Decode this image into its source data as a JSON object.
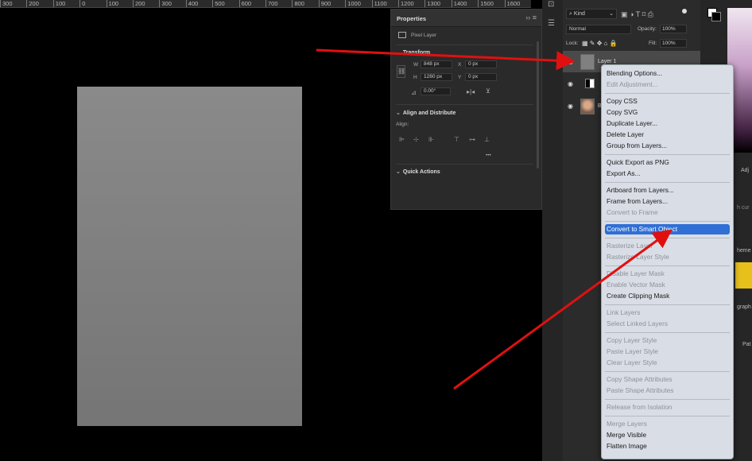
{
  "ruler": {
    "ticks": [
      "300",
      "200",
      "100",
      "0",
      "100",
      "200",
      "300",
      "400",
      "500",
      "600",
      "700",
      "800",
      "900",
      "1000",
      "1100",
      "1200",
      "1300",
      "1400",
      "1500",
      "1600"
    ]
  },
  "properties": {
    "title": "Properties",
    "layer_type": "Pixel Layer",
    "transform_title": "Transform",
    "w_label": "W",
    "w_value": "848 px",
    "x_label": "X",
    "x_value": "0 px",
    "h_label": "H",
    "h_value": "1280 px",
    "y_label": "Y",
    "y_value": "0 px",
    "angle_value": "0.00°",
    "align_title": "Align and Distribute",
    "align_label": "Align:",
    "more": "•••",
    "quick_actions_title": "Quick Actions"
  },
  "layers_panel": {
    "kind": "Kind",
    "blend_mode": "Normal",
    "opacity_label": "Opacity:",
    "opacity_value": "100%",
    "lock_label": "Lock:",
    "fill_label": "Fill:",
    "fill_value": "100%",
    "layers": [
      {
        "name": "Layer 1"
      },
      {
        "name": ""
      },
      {
        "name": "B"
      }
    ]
  },
  "right_panel": {
    "adj": "Adj",
    "cur": "h cur",
    "theme": "heme",
    "graph": "graph",
    "pat": "Pat"
  },
  "context_menu": {
    "items": [
      {
        "label": "Blending Options...",
        "disabled": false
      },
      {
        "label": "Edit Adjustment...",
        "disabled": true
      },
      {
        "sep": true
      },
      {
        "label": "Copy CSS",
        "disabled": false
      },
      {
        "label": "Copy SVG",
        "disabled": false
      },
      {
        "label": "Duplicate Layer...",
        "disabled": false
      },
      {
        "label": "Delete Layer",
        "disabled": false
      },
      {
        "label": "Group from Layers...",
        "disabled": false
      },
      {
        "sep": true
      },
      {
        "label": "Quick Export as PNG",
        "disabled": false
      },
      {
        "label": "Export As...",
        "disabled": false
      },
      {
        "sep": true
      },
      {
        "label": "Artboard from Layers...",
        "disabled": false
      },
      {
        "label": "Frame from Layers...",
        "disabled": false
      },
      {
        "label": "Convert to Frame",
        "disabled": true
      },
      {
        "sep": true
      },
      {
        "label": "Convert to Smart Object",
        "disabled": false,
        "highlighted": true
      },
      {
        "sep": true
      },
      {
        "label": "Rasterize Layer",
        "disabled": true
      },
      {
        "label": "Rasterize Layer Style",
        "disabled": true
      },
      {
        "sep": true
      },
      {
        "label": "Disable Layer Mask",
        "disabled": true
      },
      {
        "label": "Enable Vector Mask",
        "disabled": true
      },
      {
        "label": "Create Clipping Mask",
        "disabled": false
      },
      {
        "sep": true
      },
      {
        "label": "Link Layers",
        "disabled": true
      },
      {
        "label": "Select Linked Layers",
        "disabled": true
      },
      {
        "sep": true
      },
      {
        "label": "Copy Layer Style",
        "disabled": true
      },
      {
        "label": "Paste Layer Style",
        "disabled": true
      },
      {
        "label": "Clear Layer Style",
        "disabled": true
      },
      {
        "sep": true
      },
      {
        "label": "Copy Shape Attributes",
        "disabled": true
      },
      {
        "label": "Paste Shape Attributes",
        "disabled": true
      },
      {
        "sep": true
      },
      {
        "label": "Release from Isolation",
        "disabled": true
      },
      {
        "sep": true
      },
      {
        "label": "Merge Layers",
        "disabled": true
      },
      {
        "label": "Merge Visible",
        "disabled": false
      },
      {
        "label": "Flatten Image",
        "disabled": false
      }
    ]
  },
  "colors": {
    "accent": "#2f6fd6",
    "arrow": "#e01010",
    "swatch": "#e7c01c"
  }
}
